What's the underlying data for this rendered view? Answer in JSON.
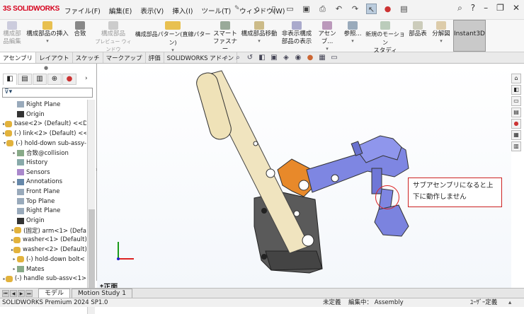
{
  "app": {
    "logo": "3S SOLIDWORKS"
  },
  "menu": [
    "ファイル(F)",
    "編集(E)",
    "表示(V)",
    "挿入(I)",
    "ツール(T)",
    "ウィンドウ(W)"
  ],
  "ribbon": {
    "buttons": [
      {
        "label1": "構成部",
        "label2": "品編集",
        "dim": true
      },
      {
        "label1": "構成部品の挿入",
        "label2": ""
      },
      {
        "label1": "合致",
        "label2": ""
      },
      {
        "label1": "構成部品",
        "label2": "プレビュー ウィンドウ",
        "dim": true
      },
      {
        "label1": "構成部品パターン(直線パターン)",
        "label2": ""
      },
      {
        "label1": "スマート",
        "label2": "ファスナー"
      },
      {
        "label1": "構成部品移動",
        "label2": ""
      },
      {
        "label1": "非表示構成",
        "label2": "部品の表示"
      },
      {
        "label1": "アセンブ...",
        "label2": ""
      },
      {
        "label1": "参照...",
        "label2": ""
      },
      {
        "label1": "新規のモーション",
        "label2": "スタディ"
      },
      {
        "label1": "部品表",
        "label2": ""
      },
      {
        "label1": "分解図",
        "label2": ""
      }
    ],
    "instant3d": "Instant3D"
  },
  "tabs": [
    "アセンブリ",
    "レイアウト",
    "スケッチ",
    "マークアップ",
    "評価",
    "SOLIDWORKS アドイン"
  ],
  "tree": [
    {
      "label": "Right Plane",
      "icon": "plane-icon",
      "indent": 1,
      "arrow": ""
    },
    {
      "label": "Origin",
      "icon": "origin-icon",
      "indent": 1,
      "arrow": ""
    },
    {
      "label": "base<2> (Default) <<D",
      "icon": "part-icon",
      "indent": 0,
      "arrow": "▸"
    },
    {
      "label": "(-) link<2> (Default) <<",
      "icon": "part-icon",
      "indent": 0,
      "arrow": "▸"
    },
    {
      "label": "(-) hold-down sub-assy-",
      "icon": "assembly-icon",
      "indent": 0,
      "arrow": "▾"
    },
    {
      "label": "合致@collision",
      "icon": "mates-icon",
      "indent": 1,
      "arrow": "▸"
    },
    {
      "label": "History",
      "icon": "history-icon",
      "indent": 1,
      "arrow": ""
    },
    {
      "label": "Sensors",
      "icon": "sensor-icon",
      "indent": 1,
      "arrow": ""
    },
    {
      "label": "Annotations",
      "icon": "annotation-icon",
      "indent": 1,
      "arrow": "▸"
    },
    {
      "label": "Front Plane",
      "icon": "plane-icon",
      "indent": 1,
      "arrow": ""
    },
    {
      "label": "Top Plane",
      "icon": "plane-icon",
      "indent": 1,
      "arrow": ""
    },
    {
      "label": "Right Plane",
      "icon": "plane-icon",
      "indent": 1,
      "arrow": ""
    },
    {
      "label": "Origin",
      "icon": "origin-icon",
      "indent": 1,
      "arrow": ""
    },
    {
      "label": "(固定) arm<1> (Defa",
      "icon": "part-icon",
      "indent": 1,
      "arrow": "▸"
    },
    {
      "label": "washer<1> (Default)",
      "icon": "part-icon",
      "indent": 1,
      "arrow": "▸"
    },
    {
      "label": "washer<2> (Default)",
      "icon": "part-icon",
      "indent": 1,
      "arrow": "▸"
    },
    {
      "label": "(-) hold-down bolt<",
      "icon": "part-icon",
      "indent": 1,
      "arrow": "▸"
    },
    {
      "label": "Mates",
      "icon": "mates-icon",
      "indent": 1,
      "arrow": "▸"
    },
    {
      "label": "(-) handle sub-assv<1>",
      "icon": "assembly-icon",
      "indent": 0,
      "arrow": "▸"
    }
  ],
  "viewport": {
    "annotation": "サブアセンブリになると上下に動作しません",
    "view_label": "*正面"
  },
  "bottom_tabs": [
    "モデル",
    "Motion Study 1"
  ],
  "status": {
    "version": "SOLIDWORKS Premium 2024 SP1.0",
    "definition": "未定義",
    "editing": "編集中： Assembly",
    "units": "ﾕｰｻﾞｰ定義"
  }
}
